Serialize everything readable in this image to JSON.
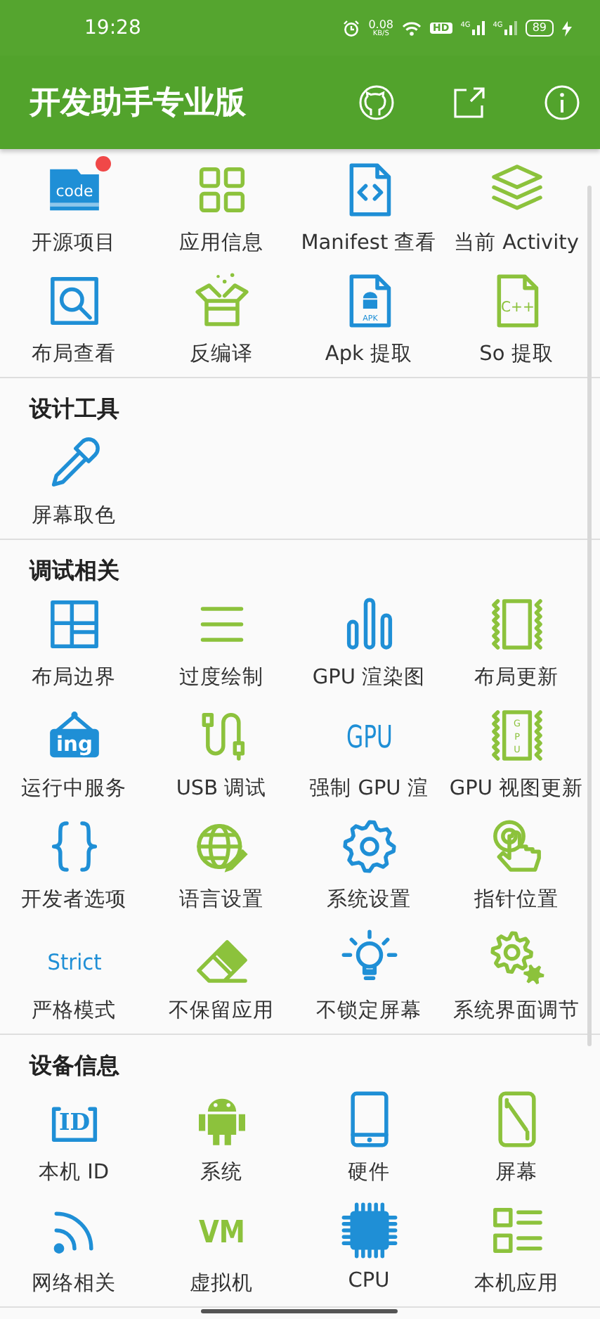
{
  "status_bar": {
    "time": "19:28",
    "speed": "0.08",
    "speed_unit": "KB/S",
    "hd": "HD",
    "network_1": "4G",
    "network_2": "4G",
    "battery": "89"
  },
  "toolbar": {
    "title": "开发助手专业版"
  },
  "sections": [
    {
      "items": [
        {
          "label": "开源项目",
          "kind": "code",
          "icon_text": "code",
          "badge": true
        },
        {
          "label": "应用信息",
          "kind": "grid",
          "badge": false
        },
        {
          "label": "Manifest 查看",
          "kind": "xmlfile",
          "badge": false
        },
        {
          "label": "当前 Activity",
          "kind": "layers",
          "badge": false
        },
        {
          "label": "布局查看",
          "kind": "inspect",
          "badge": false
        },
        {
          "label": "反编译",
          "kind": "box",
          "badge": false
        },
        {
          "label": "Apk 提取",
          "kind": "apkfile",
          "icon_text": "APK",
          "badge": false
        },
        {
          "label": "So 提取",
          "kind": "cppfile",
          "icon_text": "C++",
          "badge": false
        }
      ]
    },
    {
      "title": "设计工具",
      "items": [
        {
          "label": "屏幕取色",
          "kind": "dropper"
        }
      ]
    },
    {
      "title": "调试相关",
      "items": [
        {
          "label": "布局边界",
          "kind": "bounds"
        },
        {
          "label": "过度绘制",
          "kind": "lines"
        },
        {
          "label": "GPU 渲染图",
          "kind": "bars"
        },
        {
          "label": "布局更新",
          "kind": "zigzag"
        },
        {
          "label": "运行中服务",
          "kind": "sign",
          "icon_text": "ing"
        },
        {
          "label": "USB 调试",
          "kind": "usb"
        },
        {
          "label": "强制 GPU 渲",
          "kind": "word",
          "icon_text": "GPU"
        },
        {
          "label": "GPU 视图更新",
          "kind": "zigzagtext",
          "icon_text": "GPU"
        },
        {
          "label": "开发者选项",
          "kind": "braces"
        },
        {
          "label": "语言设置",
          "kind": "globe"
        },
        {
          "label": "系统设置",
          "kind": "gear"
        },
        {
          "label": "指针位置",
          "kind": "hand"
        },
        {
          "label": "严格模式",
          "kind": "word",
          "icon_text": "Strict"
        },
        {
          "label": "不保留应用",
          "kind": "eraser"
        },
        {
          "label": "不锁定屏幕",
          "kind": "bulb"
        },
        {
          "label": "系统界面调节",
          "kind": "gears"
        }
      ]
    },
    {
      "title": "设备信息",
      "items": [
        {
          "label": "本机 ID",
          "kind": "idframe",
          "icon_text": "ID"
        },
        {
          "label": "系统",
          "kind": "android"
        },
        {
          "label": "硬件",
          "kind": "phone"
        },
        {
          "label": "屏幕",
          "kind": "screen"
        },
        {
          "label": "网络相关",
          "kind": "wifi"
        },
        {
          "label": "虚拟机",
          "kind": "wordgreen",
          "icon_text": "VM"
        },
        {
          "label": "CPU",
          "kind": "chip"
        },
        {
          "label": "本机应用",
          "kind": "list"
        }
      ]
    }
  ]
}
